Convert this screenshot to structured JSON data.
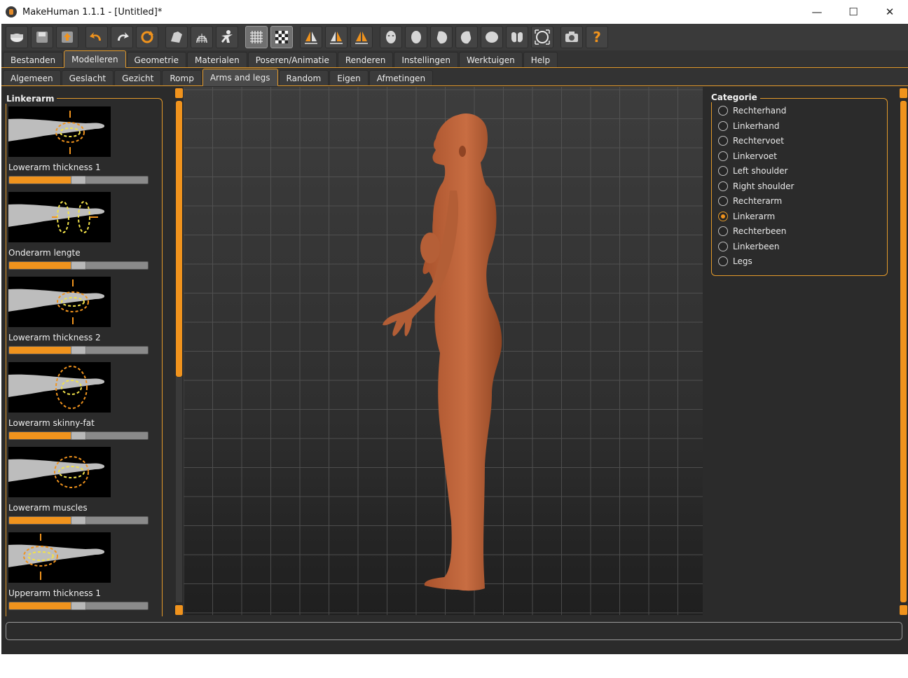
{
  "window": {
    "title": "MakeHuman 1.1.1 - [Untitled]*",
    "minimize": "—",
    "maximize": "☐",
    "close": "✕"
  },
  "toolbar": {
    "buttons": [
      {
        "name": "new-icon"
      },
      {
        "name": "save-icon"
      },
      {
        "name": "export-icon"
      },
      {
        "name": "undo-icon"
      },
      {
        "name": "redo-icon"
      },
      {
        "name": "reset-icon"
      },
      {
        "name": "smooth-icon"
      },
      {
        "name": "wireframe-icon"
      },
      {
        "name": "pose-icon"
      },
      {
        "name": "grid-icon",
        "active": true
      },
      {
        "name": "checker-icon",
        "active": true
      },
      {
        "name": "symmetry-right-icon"
      },
      {
        "name": "symmetry-left-icon"
      },
      {
        "name": "symmetry-icon"
      },
      {
        "name": "front-view-icon"
      },
      {
        "name": "back-view-icon"
      },
      {
        "name": "left-view-icon"
      },
      {
        "name": "right-view-icon"
      },
      {
        "name": "top-view-icon"
      },
      {
        "name": "bottom-view-icon"
      },
      {
        "name": "reset-camera-icon"
      },
      {
        "name": "screenshot-icon"
      },
      {
        "name": "help-icon"
      }
    ]
  },
  "main_tabs": [
    {
      "label": "Bestanden"
    },
    {
      "label": "Modelleren",
      "active": true
    },
    {
      "label": "Geometrie"
    },
    {
      "label": "Materialen"
    },
    {
      "label": "Poseren/Animatie"
    },
    {
      "label": "Renderen"
    },
    {
      "label": "Instellingen"
    },
    {
      "label": "Werktuigen"
    },
    {
      "label": "Help"
    }
  ],
  "sub_tabs": [
    {
      "label": "Algemeen"
    },
    {
      "label": "Geslacht"
    },
    {
      "label": "Gezicht"
    },
    {
      "label": "Romp"
    },
    {
      "label": "Arms and legs",
      "active": true
    },
    {
      "label": "Random"
    },
    {
      "label": "Eigen"
    },
    {
      "label": "Afmetingen"
    }
  ],
  "left_panel": {
    "title": "Linkerarm",
    "sliders": [
      {
        "label": "Lowerarm thickness 1",
        "value": 0.5
      },
      {
        "label": "Onderarm lengte",
        "value": 0.5
      },
      {
        "label": "Lowerarm thickness 2",
        "value": 0.5
      },
      {
        "label": "Lowerarm skinny-fat",
        "value": 0.5
      },
      {
        "label": "Lowerarm muscles",
        "value": 0.5
      },
      {
        "label": "Upperarm thickness 1",
        "value": 0.5
      }
    ]
  },
  "right_panel": {
    "title": "Categorie",
    "options": [
      {
        "label": "Rechterhand"
      },
      {
        "label": "Linkerhand"
      },
      {
        "label": "Rechtervoet"
      },
      {
        "label": "Linkervoet"
      },
      {
        "label": "Left shoulder"
      },
      {
        "label": "Right shoulder"
      },
      {
        "label": "Rechterarm"
      },
      {
        "label": "Linkerarm",
        "checked": true
      },
      {
        "label": "Rechterbeen"
      },
      {
        "label": "Linkerbeen"
      },
      {
        "label": "Legs"
      }
    ]
  },
  "colors": {
    "accent": "#f0931d",
    "skin": "#c0683e",
    "background": "#2b2b2b"
  }
}
